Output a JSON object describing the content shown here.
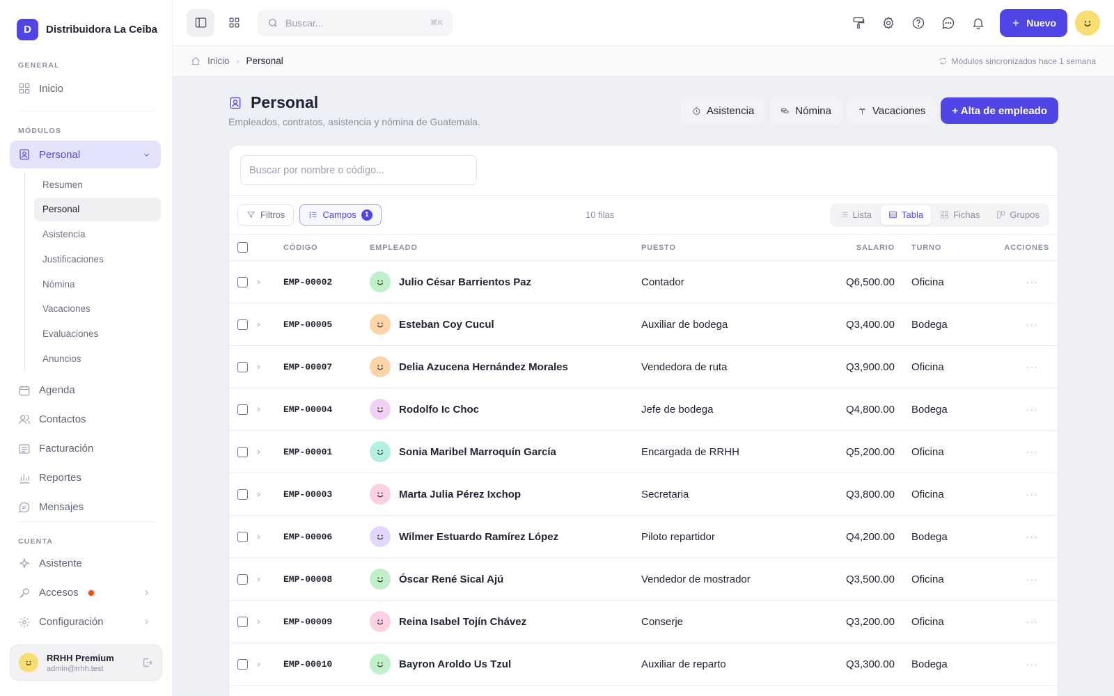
{
  "brand": {
    "initial": "D",
    "name": "Distribuidora La Ceiba"
  },
  "sidebar": {
    "general_label": "GENERAL",
    "inicio": "Inicio",
    "modulos_label": "MÓDULOS",
    "personal": "Personal",
    "sub_items": [
      "Resumen",
      "Personal",
      "Asistencia",
      "Justificaciones",
      "Nómina",
      "Vacaciones",
      "Evaluaciones",
      "Anuncios"
    ],
    "modules": [
      "Agenda",
      "Contactos",
      "Facturación",
      "Reportes",
      "Mensajes"
    ],
    "cuenta_label": "CUENTA",
    "asistente": "Asistente",
    "accesos": "Accesos",
    "configuracion": "Configuración"
  },
  "user": {
    "name": "RRHH Premium",
    "email": "admin@rrhh.test"
  },
  "topbar": {
    "search_placeholder": "Buscar...",
    "shortcut": "⌘K",
    "new_label": "Nuevo"
  },
  "breadcrumb": {
    "home": "Inicio",
    "current": "Personal",
    "sync_status": "Módulos sincronizados hace 1 semana"
  },
  "page": {
    "title": "Personal",
    "subtitle": "Empleados, contratos, asistencia y nómina de Guatemala.",
    "actions": {
      "asistencia": "Asistencia",
      "nomina": "Nómina",
      "vacaciones": "Vacaciones",
      "alta": "+ Alta de empleado"
    }
  },
  "table_tools": {
    "search_placeholder": "Buscar por nombre o código...",
    "filtros": "Filtros",
    "campos": "Campos",
    "campos_count": "1",
    "row_count": "10 filas",
    "views": [
      "Lista",
      "Tabla",
      "Fichas",
      "Grupos"
    ]
  },
  "table": {
    "headers": {
      "codigo": "CÓDIGO",
      "empleado": "EMPLEADO",
      "puesto": "PUESTO",
      "salario": "SALARIO",
      "turno": "TURNO",
      "acciones": "ACCIONES"
    },
    "rows": [
      {
        "code": "EMP-00002",
        "name": "Julio César Barrientos Paz",
        "puesto": "Contador",
        "salario": "Q6,500.00",
        "turno": "Oficina",
        "color": "#bff0c9"
      },
      {
        "code": "EMP-00005",
        "name": "Esteban Coy Cucul",
        "puesto": "Auxiliar de bodega",
        "salario": "Q3,400.00",
        "turno": "Bodega",
        "color": "#fdd4a8"
      },
      {
        "code": "EMP-00007",
        "name": "Delia Azucena Hernández Morales",
        "puesto": "Vendedora de ruta",
        "salario": "Q3,900.00",
        "turno": "Oficina",
        "color": "#fdd4a8"
      },
      {
        "code": "EMP-00004",
        "name": "Rodolfo Ic Choc",
        "puesto": "Jefe de bodega",
        "salario": "Q4,800.00",
        "turno": "Bodega",
        "color": "#f2d0f5"
      },
      {
        "code": "EMP-00001",
        "name": "Sonia Maribel Marroquín García",
        "puesto": "Encargada de RRHH",
        "salario": "Q5,200.00",
        "turno": "Oficina",
        "color": "#b3f0e3"
      },
      {
        "code": "EMP-00003",
        "name": "Marta Julia Pérez Ixchop",
        "puesto": "Secretaria",
        "salario": "Q3,800.00",
        "turno": "Oficina",
        "color": "#fbd0e3"
      },
      {
        "code": "EMP-00006",
        "name": "Wilmer Estuardo Ramírez López",
        "puesto": "Piloto repartidor",
        "salario": "Q4,200.00",
        "turno": "Bodega",
        "color": "#e2d6fb"
      },
      {
        "code": "EMP-00008",
        "name": "Óscar René Sical Ajú",
        "puesto": "Vendedor de mostrador",
        "salario": "Q3,500.00",
        "turno": "Oficina",
        "color": "#bff0c9"
      },
      {
        "code": "EMP-00009",
        "name": "Reina Isabel Tojín Chávez",
        "puesto": "Conserje",
        "salario": "Q3,200.00",
        "turno": "Oficina",
        "color": "#fbd0e3"
      },
      {
        "code": "EMP-00010",
        "name": "Bayron Aroldo Us Tzul",
        "puesto": "Auxiliar de reparto",
        "salario": "Q3,300.00",
        "turno": "Bodega",
        "color": "#bff0c9"
      }
    ]
  },
  "colors": {
    "accent": "#4f46e5",
    "notification_dot": "#e0531f"
  }
}
